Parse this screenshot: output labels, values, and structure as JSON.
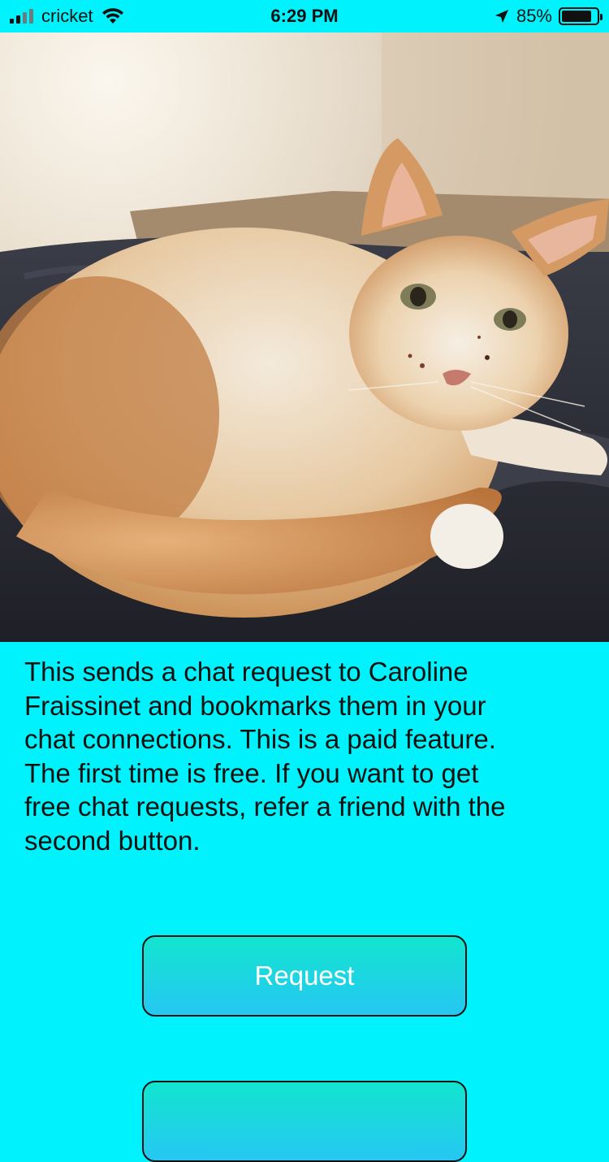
{
  "status_bar": {
    "carrier": "cricket",
    "time": "6:29 PM",
    "battery_percent": "85%",
    "battery_level": 0.85
  },
  "profile_photo": {
    "subject": "orange and white cat lying on dark bedspread"
  },
  "description": "This sends a chat request to Caroline\nFraissinet  and bookmarks them in your\nchat connections.  This is a paid feature.\nThe first time is free.  If you want to get\nfree chat requests, refer a friend with the\nsecond button.",
  "buttons": {
    "request_label": "Request",
    "second_label": ""
  },
  "colors": {
    "background": "#00f3fc",
    "button_gradient_top": "#12e5cf",
    "button_gradient_bottom": "#26c7f2",
    "button_text": "#ffffff"
  }
}
